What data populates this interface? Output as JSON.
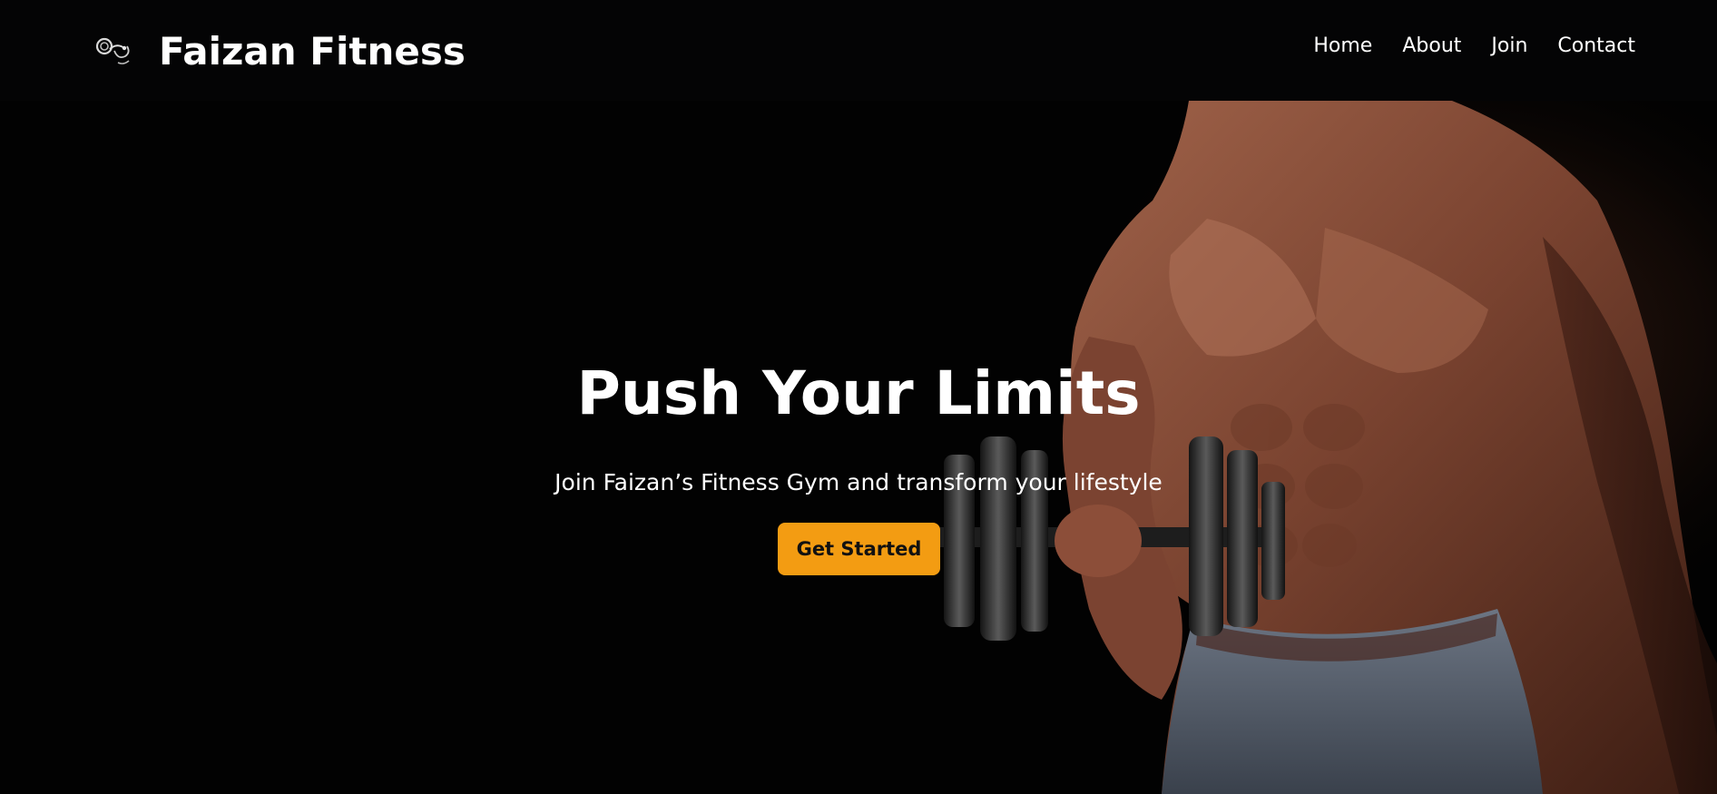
{
  "brand": {
    "name": "Faizan Fitness",
    "logo_icon": "dumbbell-logo-icon"
  },
  "nav": {
    "items": [
      {
        "label": "Home"
      },
      {
        "label": "About"
      },
      {
        "label": "Join"
      },
      {
        "label": "Contact"
      }
    ]
  },
  "hero": {
    "title": "Push Your Limits",
    "subtitle": "Join Faizan’s Fitness Gym and transform your lifestyle",
    "cta_label": "Get Started",
    "background_image": "muscular man holding a dumbbell on dark background"
  },
  "colors": {
    "background": "#020202",
    "navbar": "#040405",
    "text": "#ffffff",
    "accent": "#f39c12",
    "button_text": "#111111"
  }
}
